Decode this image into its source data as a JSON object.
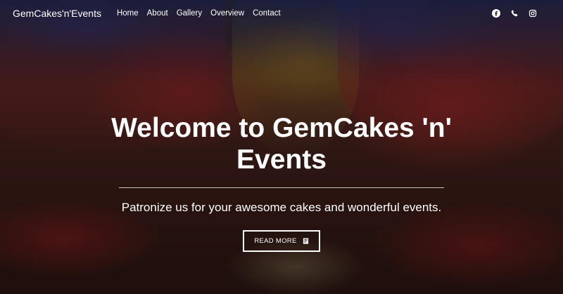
{
  "nav": {
    "brand": "GemCakes'n'Events",
    "links": [
      "Home",
      "About",
      "Gallery",
      "Overview",
      "Contact"
    ]
  },
  "socials": [
    {
      "icon": "facebook-icon"
    },
    {
      "icon": "phone-icon"
    },
    {
      "icon": "instagram-icon"
    }
  ],
  "hero": {
    "title": "Welcome to GemCakes 'n' Events",
    "subtitle": "Patronize us for your awesome cakes and wonderful events.",
    "cta_label": "READ MORE",
    "cta_icon": "book-icon"
  }
}
